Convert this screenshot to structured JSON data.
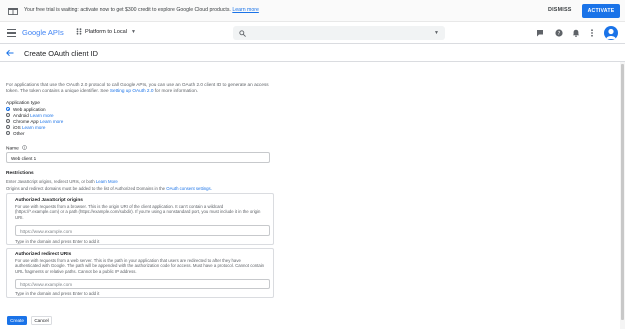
{
  "banner": {
    "message": "Your free trial is waiting: activate now to get $300 credit to explore Google Cloud products.",
    "learn_more": "Learn more",
    "dismiss_label": "DISMISS",
    "activate_label": "ACTIVATE"
  },
  "appbar": {
    "logo_text": "Google APIs",
    "project_name": "Platform to Local",
    "search_placeholder": ""
  },
  "page": {
    "title": "Create OAuth client ID"
  },
  "form": {
    "intro_text": "For applications that use the OAuth 2.0 protocol to call Google APIs, you can use an OAuth 2.0 client ID to generate an access token. The token contains a unique identifier. See",
    "intro_link": "Setting up OAuth 2.0",
    "intro_tail": "for more information.",
    "app_type_label": "Application type",
    "app_types": [
      {
        "label": "Web application",
        "link": "",
        "selected": true
      },
      {
        "label": "Android",
        "link": "Learn more",
        "selected": false
      },
      {
        "label": "Chrome App",
        "link": "Learn more",
        "selected": false
      },
      {
        "label": "iOS",
        "link": "Learn more",
        "selected": false
      },
      {
        "label": "Other",
        "link": "",
        "selected": false
      }
    ],
    "name_label": "Name",
    "name_value": "Web client 1",
    "restrictions_label": "Restrictions",
    "restrictions_help": "Enter JavaScript origins, redirect URIs, or both",
    "restrictions_help_link": "Learn More",
    "restrictions_note": "Origins and redirect domains must be added to the list of Authorized Domains in the",
    "restrictions_note_link": "OAuth consent settings.",
    "js_origins": {
      "title": "Authorized JavaScript origins",
      "description": "For use with requests from a browser. This is the origin URI of the client application. It can't contain a wildcard (https://*.example.com) or a path (https://example.com/subdir). If you're using a nonstandard port, you must include it in the origin URI.",
      "placeholder": "https://www.example.com",
      "hint": "Type in the domain and press Enter to add it"
    },
    "redirect_uris": {
      "title": "Authorized redirect URIs",
      "description": "For use with requests from a web server. This is the path in your application that users are redirected to after they have authenticated with Google. The path will be appended with the authorization code for access. Must have a protocol. Cannot contain URL fragments or relative paths. Cannot be a public IP address.",
      "placeholder": "https://www.example.com",
      "hint": "Type in the domain and press Enter to add it"
    },
    "create_label": "Create",
    "cancel_label": "Cancel"
  },
  "colors": {
    "accent": "#1a73e8",
    "text": "#202124",
    "muted": "#5f6368"
  }
}
